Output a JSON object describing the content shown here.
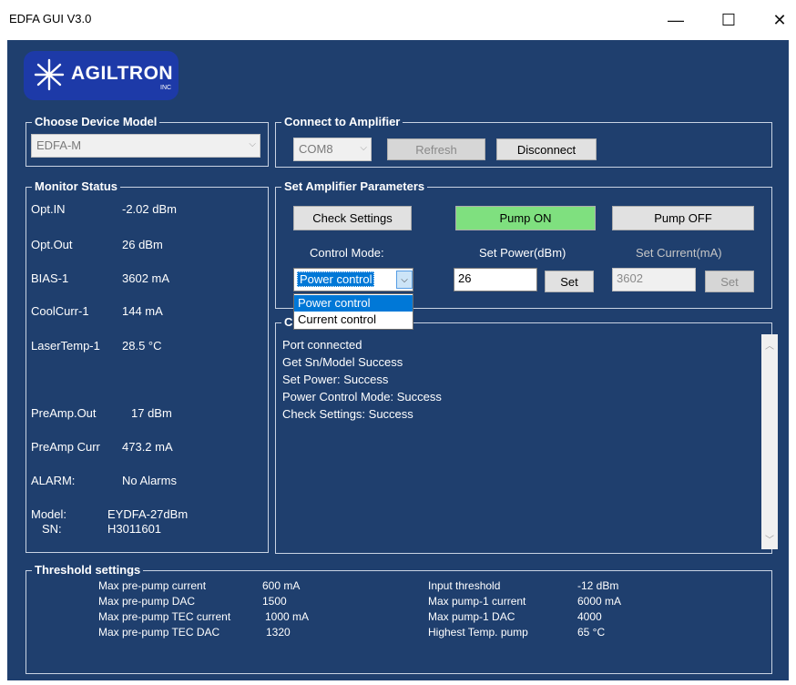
{
  "window": {
    "title": "EDFA GUI V3.0",
    "minimize": "—",
    "maximize": "☐",
    "close": "✕"
  },
  "logo": {
    "brand": "AGILTRON",
    "inc": "INC"
  },
  "device": {
    "title": "Choose Device Model",
    "model": "EDFA-M"
  },
  "connect": {
    "title": "Connect to Amplifier",
    "port": "COM8",
    "refresh": "Refresh",
    "disconnect": "Disconnect"
  },
  "monitor": {
    "title": "Monitor Status",
    "items": [
      {
        "label": "Opt.IN",
        "value": "-2.02 dBm"
      },
      {
        "label": "Opt.Out",
        "value": "26 dBm"
      },
      {
        "label": "BIAS-1",
        "value": "3602 mA"
      },
      {
        "label": "CoolCurr-1",
        "value": "144 mA"
      },
      {
        "label": "LaserTemp-1",
        "value": "28.5 °C"
      },
      {
        "label": "PreAmp.Out",
        "value": "17 dBm"
      },
      {
        "label": "PreAmp Curr",
        "value": "473.2 mA"
      },
      {
        "label": "ALARM:",
        "value": "No Alarms"
      }
    ],
    "model_label": "Model:",
    "model_value": "EYDFA-27dBm",
    "sn_label": "SN:",
    "sn_value": "H3011601"
  },
  "params": {
    "title": "Set Amplifier Parameters",
    "check": "Check Settings",
    "pump_on": "Pump ON",
    "pump_off": "Pump OFF",
    "control_mode_label": "Control Mode:",
    "control_mode": "Power control",
    "set_power_label": "Set Power(dBm)",
    "set_power_value": "26",
    "set_power_btn": "Set",
    "set_current_label": "Set Current(mA)",
    "set_current_value": "3602",
    "set_current_btn": "Set",
    "options": [
      "Power control",
      "Current control"
    ]
  },
  "log": {
    "title_fragment": "C",
    "lines": [
      "Port connected",
      "Get Sn/Model Success",
      "Set Power: Success",
      "Power Control Mode: Success",
      "Check Settings: Success"
    ]
  },
  "thresholds": {
    "title": "Threshold settings",
    "left": [
      {
        "label": "Max pre-pump current",
        "value": "600 mA"
      },
      {
        "label": "Max pre-pump DAC",
        "value": "1500"
      },
      {
        "label": "Max pre-pump TEC current",
        "value": "1000 mA"
      },
      {
        "label": "Max pre-pump TEC DAC",
        "value": "1320"
      }
    ],
    "right": [
      {
        "label": "Input threshold",
        "value": "-12 dBm"
      },
      {
        "label": "Max pump-1 current",
        "value": "6000 mA"
      },
      {
        "label": "Max pump-1 DAC",
        "value": "4000"
      },
      {
        "label": "Highest Temp. pump",
        "value": "65 °C"
      }
    ]
  },
  "colors": {
    "background": "#1f3f6e",
    "pump_on": "#7fe07f",
    "selection": "#0078d7"
  }
}
